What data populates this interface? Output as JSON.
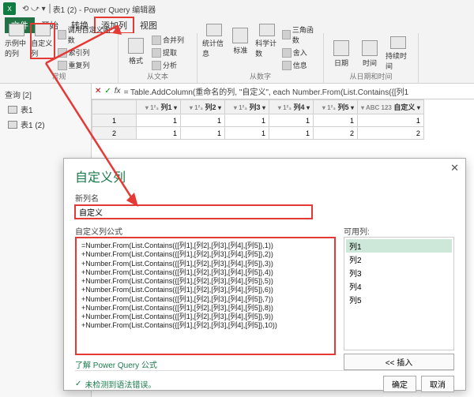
{
  "title": "表1 (2) - Power Query 编辑器",
  "menu": {
    "file": "文件",
    "home": "开始",
    "transform": "转换",
    "addcol": "添加列",
    "view": "视图"
  },
  "ribbon": {
    "examplecol": "示例中的列",
    "customcol": "自定义列",
    "invokefn": "调用自定义函数",
    "indexcol": "索引列",
    "dupcol": "重复列",
    "group_general": "常规",
    "format": "格式",
    "mergecol": "合并列",
    "extract": "提取",
    "parse": "分析",
    "group_text": "从文本",
    "stats": "统计信息",
    "standard": "标准",
    "scientific": "科学计数",
    "trig": "三角函数",
    "round": "舍入",
    "info": "信息",
    "group_number": "从数字",
    "date": "日期",
    "time": "时间",
    "duration": "持续时间",
    "group_datetime": "从日期和时间"
  },
  "sidebar": {
    "head": "查询 [2]",
    "items": [
      "表1",
      "表1 (2)"
    ]
  },
  "fxlabel": "fx",
  "formula": "= Table.AddColumn(重命名的列, \"自定义\", each Number.From(List.Contains({[列1",
  "grid": {
    "headers": [
      "列1",
      "列2",
      "列3",
      "列4",
      "列5",
      "自定义"
    ],
    "prefix": "1²₃",
    "abcprefix": "ABC 123",
    "rows": [
      [
        "1",
        "1",
        "1",
        "1",
        "1",
        "1"
      ],
      [
        "1",
        "1",
        "1",
        "1",
        "2",
        "2"
      ]
    ]
  },
  "dialog": {
    "title": "自定义列",
    "newname_label": "新列名",
    "newname_value": "自定义",
    "formula_label": "自定义列公式",
    "formulas": [
      "=Number.From(List.Contains({[列1],[列2],[列3],[列4],[列5]},1))",
      "+Number.From(List.Contains({[列1],[列2],[列3],[列4],[列5]},2))",
      "+Number.From(List.Contains({[列1],[列2],[列3],[列4],[列5]},3))",
      "+Number.From(List.Contains({[列1],[列2],[列3],[列4],[列5]},4))",
      "+Number.From(List.Contains({[列1],[列2],[列3],[列4],[列5]},5))",
      "+Number.From(List.Contains({[列1],[列2],[列3],[列4],[列5]},6))",
      "+Number.From(List.Contains({[列1],[列2],[列3],[列4],[列5]},7))",
      "+Number.From(List.Contains({[列1],[列2],[列3],[列4],[列5]},8))",
      "+Number.From(List.Contains({[列1],[列2],[列3],[列4],[列5]},9))",
      "+Number.From(List.Contains({[列1],[列2],[列3],[列4],[列5]},10))"
    ],
    "available_label": "可用列:",
    "available": [
      "列1",
      "列2",
      "列3",
      "列4",
      "列5"
    ],
    "insert": "<< 插入",
    "link": "了解 Power Query 公式",
    "status": "未检测到语法错误。",
    "ok": "确定",
    "cancel": "取消"
  }
}
